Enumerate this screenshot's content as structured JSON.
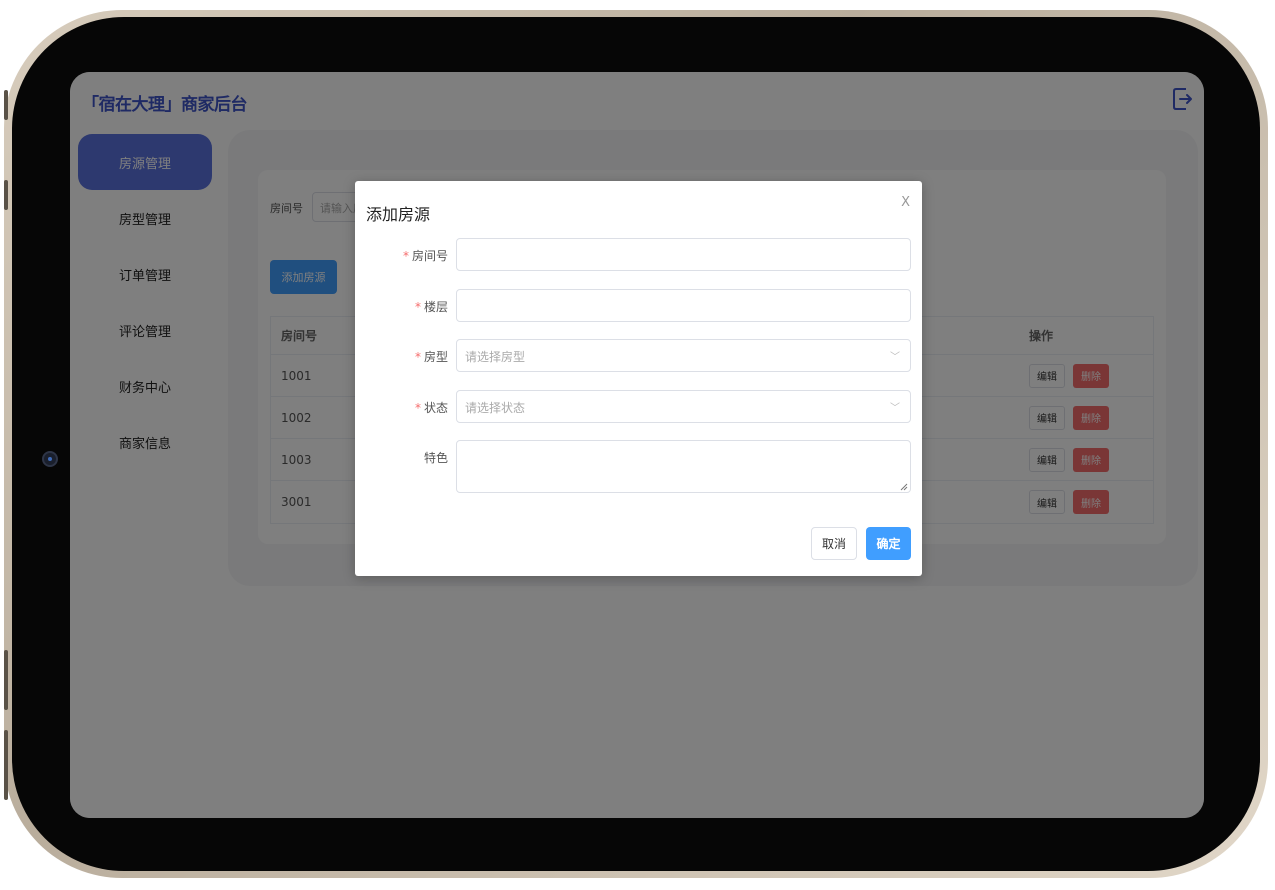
{
  "app": {
    "title": "「宿在大理」商家后台"
  },
  "sidebar": {
    "items": [
      {
        "label": "房源管理",
        "active": true
      },
      {
        "label": "房型管理"
      },
      {
        "label": "订单管理"
      },
      {
        "label": "评论管理"
      },
      {
        "label": "财务中心"
      },
      {
        "label": "商家信息"
      }
    ]
  },
  "filter": {
    "label": "房间号",
    "placeholder": "请输入房"
  },
  "toolbar": {
    "add_label": "添加房源"
  },
  "table": {
    "headers": {
      "room_number": "房间号",
      "actions": "操作"
    },
    "rows": [
      {
        "room_number": "1001"
      },
      {
        "room_number": "1002"
      },
      {
        "room_number": "1003"
      },
      {
        "room_number": "3001"
      }
    ],
    "edit_label": "编辑",
    "delete_label": "删除"
  },
  "dialog": {
    "title": "添加房源",
    "close_label": "X",
    "fields": {
      "room_number": {
        "label": "房间号",
        "required": true,
        "value": ""
      },
      "floor": {
        "label": "楼层",
        "required": true,
        "value": ""
      },
      "room_type": {
        "label": "房型",
        "required": true,
        "placeholder": "请选择房型"
      },
      "status": {
        "label": "状态",
        "required": true,
        "placeholder": "请选择状态"
      },
      "feature": {
        "label": "特色",
        "required": false,
        "value": ""
      }
    },
    "required_mark": "*",
    "cancel_label": "取消",
    "confirm_label": "确定"
  },
  "colors": {
    "accent": "#5b73de",
    "primary_button": "#409eff",
    "danger": "#f56c6c"
  },
  "icons": {
    "logout": "logout-icon",
    "dropdown": "chevron-down-icon",
    "close": "close-icon"
  }
}
